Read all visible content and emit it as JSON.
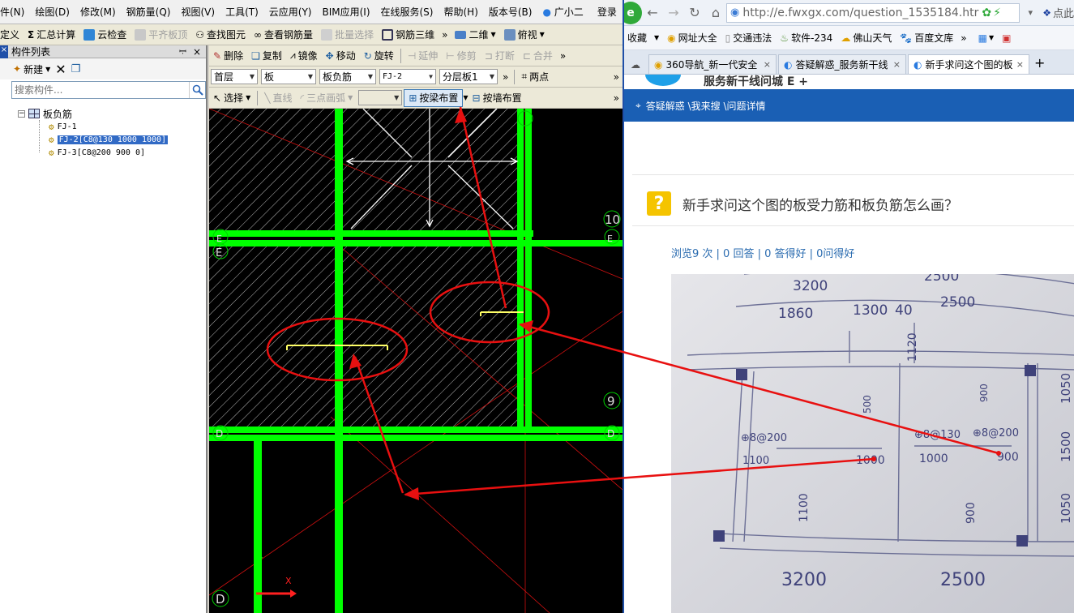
{
  "menubar": {
    "items": [
      "件(N)",
      "绘图(D)",
      "修改(M)",
      "钢筋量(Q)",
      "视图(V)",
      "工具(T)",
      "云应用(Y)",
      "BIM应用(I)",
      "在线服务(S)",
      "帮助(H)",
      "版本号(B)",
      "广小二"
    ],
    "login": "登录"
  },
  "toolbar1": {
    "items": [
      "定义",
      "汇总计算",
      "云检查",
      "平齐板顶",
      "查找图元",
      "查看钢筋量",
      "批量选择",
      "钢筋三维",
      "二维",
      "俯视"
    ]
  },
  "toolbar2": {
    "items": [
      "删除",
      "复制",
      "镜像",
      "移动",
      "旋转",
      "延伸",
      "修剪",
      "打断",
      "合并"
    ]
  },
  "toolbar3": {
    "floor": "首层",
    "type": "板",
    "subtype": "板负筋",
    "component": "FJ-2",
    "layer": "分层板1",
    "two_points": "两点"
  },
  "toolbar4": {
    "select": "选择",
    "line": "直线",
    "arc": "三点画弧",
    "by_beam": "按梁布置",
    "by_wall": "按墙布置"
  },
  "panel": {
    "title": "构件列表",
    "new_label": "新建",
    "search_placeholder": "搜索构件...",
    "root": "板负筋",
    "items": [
      "FJ-1",
      "FJ-2[C8@130 1000 1000]",
      "FJ-3[C8@200 900 0]"
    ]
  },
  "canvas": {
    "axis_labels": [
      "10",
      "E",
      "E",
      "E",
      "9",
      "D",
      "D",
      "D"
    ],
    "ucs_y": "Y",
    "ucs_x": "X"
  },
  "browser": {
    "url": "http://e.fwxgx.com/question_1535184.htr",
    "bookmarks": [
      "收藏",
      "网址大全",
      "交通违法",
      "软件-234",
      "佛山天气",
      "百度文库"
    ],
    "tabs": [
      "360导航_新一代安全",
      "答疑解惑_服务新干线",
      "新手求问这个图的板"
    ],
    "site_slogan": "服务新干线问城 E +",
    "breadcrumb": "答疑解惑 \\我来搜 \\问题详情",
    "question_title": "新手求问这个图的板受力筋和板负筋怎么画？",
    "stats": "浏览9 次 | 0 回答 | 0 答得好 | 0问得好",
    "user_corner": "点此"
  },
  "photo": {
    "labels": [
      "3200",
      "2500",
      "1860",
      "1300",
      "40",
      "2500",
      "1120",
      "500",
      "900",
      "1050",
      "1500",
      "1050",
      "⊕8@200",
      "⊕8@130",
      "⊕8@200",
      "1100",
      "1000",
      "1000",
      "900",
      "1100",
      "900",
      "3200",
      "2500"
    ]
  },
  "colors": {
    "canvas_bg": "#000000",
    "beam": "#00ff00",
    "rebar_highlight": "#ffff66",
    "annotation": "#e81010",
    "selection": "#316ac5",
    "site_blue": "#1a5fb4"
  }
}
